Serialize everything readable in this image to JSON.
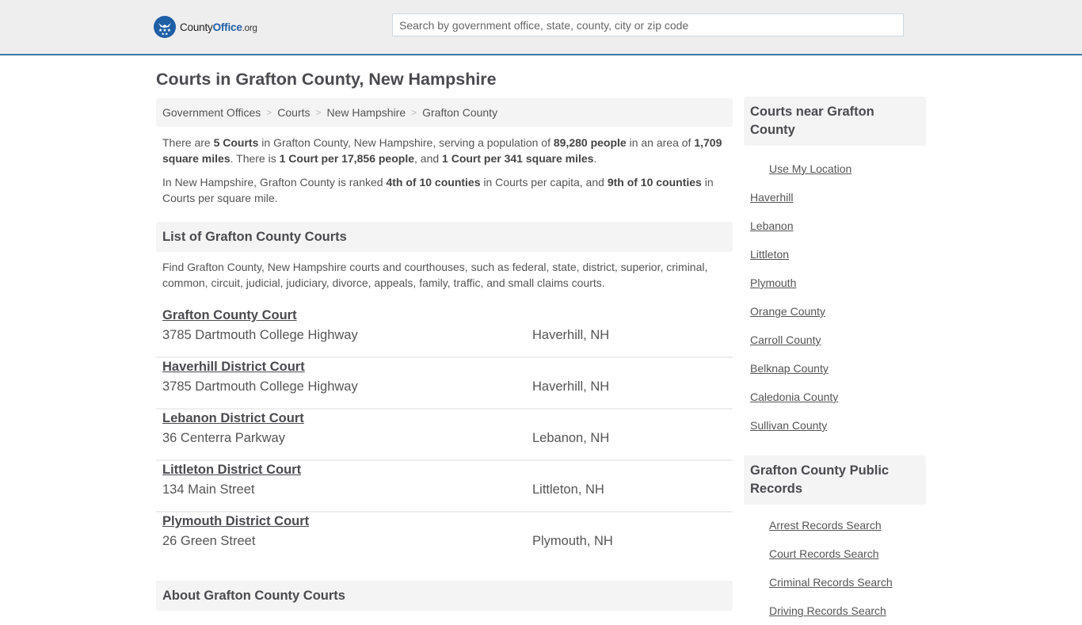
{
  "header": {
    "logo": {
      "prefix": "County",
      "brand": "Office",
      "tld": ".org"
    },
    "search": {
      "placeholder": "Search by government office, state, county, city or zip code",
      "value": ""
    }
  },
  "page_title": "Courts in Grafton County, New Hampshire",
  "breadcrumb": [
    {
      "label": "Government Offices"
    },
    {
      "label": "Courts"
    },
    {
      "label": "New Hampshire"
    },
    {
      "label": "Grafton County"
    }
  ],
  "breadcrumb_separator": ">",
  "intro": {
    "p1": {
      "t1": "There are ",
      "b1": "5 Courts",
      "t2": " in Grafton County, New Hampshire, serving a population of ",
      "b2": "89,280 people",
      "t3": " in an area of ",
      "b3": "1,709 square miles",
      "t4": ". There is ",
      "b4": "1 Court per 17,856 people",
      "t5": ", and ",
      "b5": "1 Court per 341 square miles",
      "t6": "."
    },
    "p2": {
      "t1": "In New Hampshire, Grafton County is ranked ",
      "b1": "4th of 10 counties",
      "t2": " in Courts per capita, and ",
      "b2": "9th of 10 counties",
      "t3": " in Courts per square mile."
    }
  },
  "list_section": {
    "title": "List of Grafton County Courts",
    "description": "Find Grafton County, New Hampshire courts and courthouses, such as federal, state, district, superior, criminal, common, circuit, judicial, judiciary, divorce, appeals, family, traffic, and small claims courts.",
    "courts": [
      {
        "name": "Grafton County Court",
        "address": "3785 Dartmouth College Highway",
        "city": "Haverhill, NH"
      },
      {
        "name": "Haverhill District Court",
        "address": "3785 Dartmouth College Highway",
        "city": "Haverhill, NH"
      },
      {
        "name": "Lebanon District Court",
        "address": "36 Centerra Parkway",
        "city": "Lebanon, NH"
      },
      {
        "name": "Littleton District Court",
        "address": "134 Main Street",
        "city": "Littleton, NH"
      },
      {
        "name": "Plymouth District Court",
        "address": "26 Green Street",
        "city": "Plymouth, NH"
      }
    ]
  },
  "about_section": {
    "title": "About Grafton County Courts"
  },
  "sidebar": {
    "near": {
      "title": "Courts near Grafton County",
      "use_location": "Use My Location",
      "links": [
        "Haverhill",
        "Lebanon",
        "Littleton",
        "Plymouth",
        "Orange County",
        "Carroll County",
        "Belknap County",
        "Caledonia County",
        "Sullivan County"
      ]
    },
    "records": {
      "title": "Grafton County Public Records",
      "links": [
        "Arrest Records Search",
        "Court Records Search",
        "Criminal Records Search",
        "Driving Records Search"
      ]
    }
  },
  "colors": {
    "accent": "#3a7aa8",
    "brand": "#1f5fa6",
    "panel": "#f4f4f4",
    "text": "#555555"
  }
}
